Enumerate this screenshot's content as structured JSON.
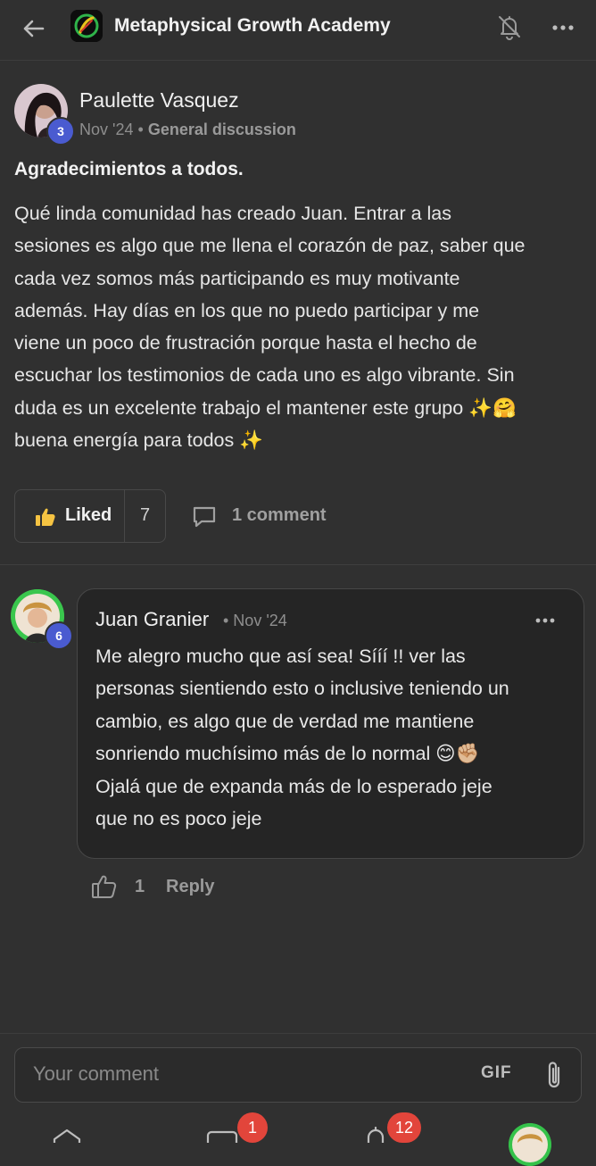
{
  "header": {
    "title": "Metaphysical Growth Academy"
  },
  "post": {
    "author": "Paulette Vasquez",
    "author_level": "3",
    "date": "Nov '24",
    "separator": "•",
    "category": "General discussion",
    "title": "Agradecimientos a todos.",
    "body": "Qué linda comunidad has creado Juan. Entrar a las\nsesiones es algo que me llena el corazón de paz, saber que\ncada vez somos más participando es muy motivante\nademás. Hay días en los que no puedo participar y me\nviene un poco de frustración porque hasta el hecho de\nescuchar los testimonios de cada uno es algo vibrante. Sin\nduda es un excelente trabajo el mantener este grupo ✨🤗\nbuena energía para todos ✨",
    "like_label": "Liked",
    "like_count": "7",
    "comment_label": "1 comment"
  },
  "comment": {
    "author": "Juan Granier",
    "author_level": "6",
    "date": "• Nov '24",
    "body": "Me alegro mucho que así sea! Sííí !! ver las\npersonas sientiendo esto o inclusive teniendo un\ncambio, es algo que de verdad me mantiene\nsonriendo muchísimo más de lo normal 😊✊🏼\nOjalá que de expanda más de lo esperado jeje\nque no es poco jeje",
    "like_count": "1",
    "reply_label": "Reply"
  },
  "composer": {
    "placeholder": "Your comment",
    "gif_label": "GIF"
  },
  "bottom_nav": {
    "chat_badge": "1",
    "notifications_badge": "12"
  },
  "colors": {
    "background": "#303030",
    "bubble": "#252525",
    "level_badge": "#4a5bd0",
    "notification_badge": "#e2453b"
  }
}
